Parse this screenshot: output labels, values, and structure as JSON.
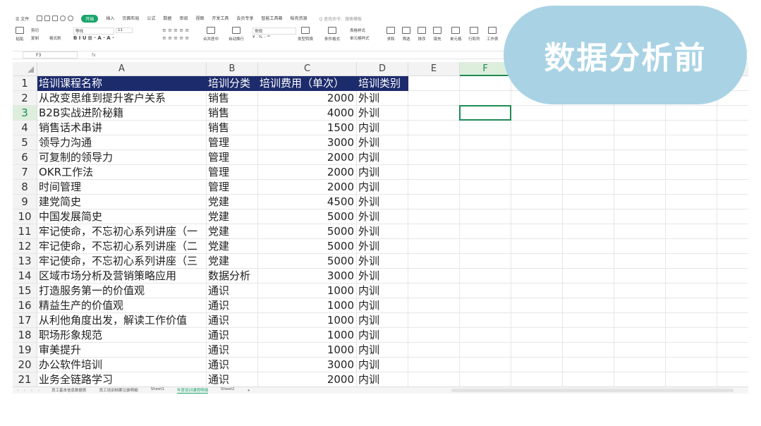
{
  "menu": {
    "file": "☰ 文件",
    "tabs": [
      "开始",
      "插入",
      "页面布局",
      "公式",
      "数据",
      "审阅",
      "视图",
      "开发工具",
      "会员专享",
      "智能工具箱",
      "稻壳资源"
    ],
    "search_placeholder": "Q 查找命令、搜索模板"
  },
  "ribbon": {
    "paste": "粘贴",
    "cut": "剪切",
    "copy": "复制",
    "format_painter": "格式刷",
    "font_name": "等线",
    "font_size": "11",
    "merge": "合并居中",
    "wrap": "自动换行",
    "number_format": "常规",
    "type_convert": "类型转换",
    "cond_format": "条件格式",
    "table_style": "表格样式",
    "cell_style": "单元格样式",
    "sum": "求和",
    "filter": "筛选",
    "sort": "排序",
    "fill": "填充",
    "cell": "单元格",
    "row_col": "行和列",
    "sheet": "工作表"
  },
  "formula": {
    "name_box": "F3",
    "fx": "fx"
  },
  "columns": [
    {
      "label": "",
      "w": 35
    },
    {
      "label": "A",
      "w": 240
    },
    {
      "label": "B",
      "w": 73
    },
    {
      "label": "C",
      "w": 140
    },
    {
      "label": "D",
      "w": 73
    },
    {
      "label": "E",
      "w": 73
    },
    {
      "label": "F",
      "w": 73
    },
    {
      "label": "",
      "w": 73
    },
    {
      "label": "",
      "w": 73
    },
    {
      "label": "",
      "w": 73
    },
    {
      "label": "",
      "w": 73
    },
    {
      "label": "",
      "w": 73
    }
  ],
  "header_row": [
    "培训课程名称",
    "培训分类",
    "培训费用（单次）",
    "培训类别"
  ],
  "rows": [
    {
      "n": "2",
      "a": "从改变思维到提升客户关系",
      "b": "销售",
      "c": "2000",
      "d": "外训"
    },
    {
      "n": "3",
      "a": "B2B实战进阶秘籍",
      "b": "销售",
      "c": "4000",
      "d": "外训"
    },
    {
      "n": "4",
      "a": "销售话术串讲",
      "b": "销售",
      "c": "1500",
      "d": "内训"
    },
    {
      "n": "5",
      "a": "领导力沟通",
      "b": "管理",
      "c": "3000",
      "d": "外训"
    },
    {
      "n": "6",
      "a": "可复制的领导力",
      "b": "管理",
      "c": "2000",
      "d": "内训"
    },
    {
      "n": "7",
      "a": "OKR工作法",
      "b": "管理",
      "c": "2000",
      "d": "内训"
    },
    {
      "n": "8",
      "a": "时间管理",
      "b": "管理",
      "c": "2000",
      "d": "内训"
    },
    {
      "n": "9",
      "a": "建党简史",
      "b": "党建",
      "c": "4500",
      "d": "外训"
    },
    {
      "n": "10",
      "a": "中国发展简史",
      "b": "党建",
      "c": "5000",
      "d": "外训"
    },
    {
      "n": "11",
      "a": "牢记使命，不忘初心系列讲座（一",
      "b": "党建",
      "c": "5000",
      "d": "外训"
    },
    {
      "n": "12",
      "a": "牢记使命，不忘初心系列讲座（二",
      "b": "党建",
      "c": "5000",
      "d": "外训"
    },
    {
      "n": "13",
      "a": "牢记使命，不忘初心系列讲座（三",
      "b": "党建",
      "c": "5000",
      "d": "外训"
    },
    {
      "n": "14",
      "a": "区域市场分析及营销策略应用",
      "b": "数据分析",
      "c": "3000",
      "d": "外训"
    },
    {
      "n": "15",
      "a": "打造服务第一的价值观",
      "b": "通识",
      "c": "1000",
      "d": "内训"
    },
    {
      "n": "16",
      "a": "精益生产的价值观",
      "b": "通识",
      "c": "1000",
      "d": "内训"
    },
    {
      "n": "17",
      "a": "从利他角度出发，解读工作价值",
      "b": "通识",
      "c": "1000",
      "d": "内训"
    },
    {
      "n": "18",
      "a": "职场形象规范",
      "b": "通识",
      "c": "1000",
      "d": "内训"
    },
    {
      "n": "19",
      "a": "审美提升",
      "b": "通识",
      "c": "1000",
      "d": "内训"
    },
    {
      "n": "20",
      "a": "办公软件培训",
      "b": "通识",
      "c": "3000",
      "d": "内训"
    },
    {
      "n": "21",
      "a": "业务全链路学习",
      "b": "通识",
      "c": "2000",
      "d": "内训"
    }
  ],
  "sheets": [
    "员工基本信息数据表",
    "员工培训档案记录明细",
    "Sheet1",
    "年度培训课程明细",
    "Sheet2"
  ],
  "active_sheet": "年度培训课程明细",
  "overlay_title": "数据分析前",
  "colors": {
    "header_fill": "#1c2b6b",
    "accent": "#1aa56b",
    "overlay": "#a9d3e4"
  }
}
